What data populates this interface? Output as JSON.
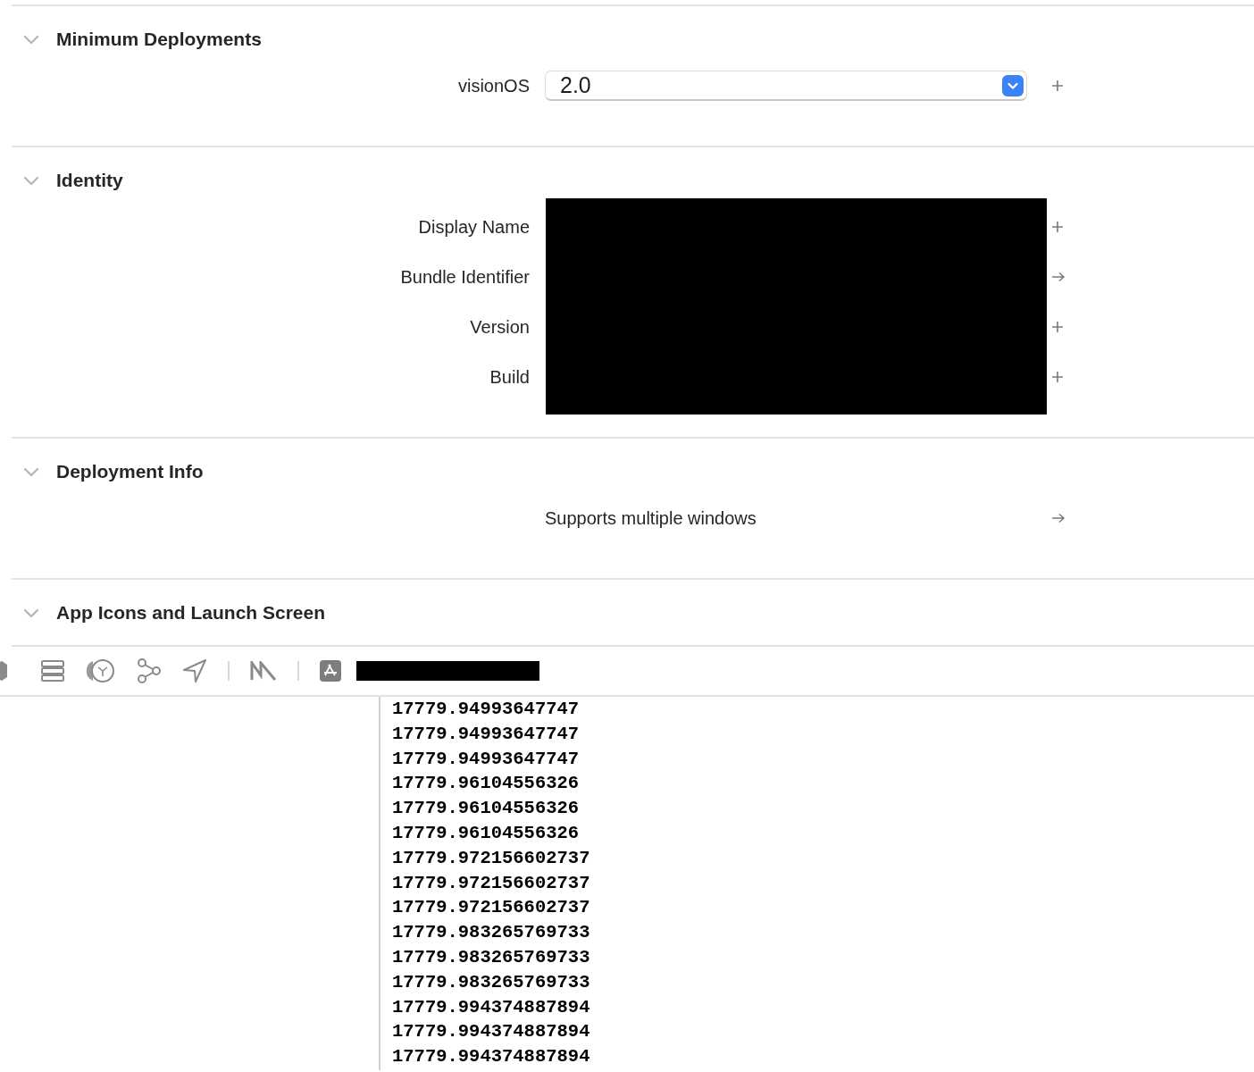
{
  "sections": [
    {
      "title": "Minimum Deployments",
      "expanded": true,
      "rows": [
        {
          "kind": "popup",
          "label": "visionOS",
          "value": "2.0",
          "action": {
            "kind": "plus"
          }
        }
      ]
    },
    {
      "title": "Identity",
      "expanded": true,
      "rows": [
        {
          "kind": "redacted",
          "label": "Display Name",
          "action": {
            "kind": "plus"
          }
        },
        {
          "kind": "redacted",
          "label": "Bundle Identifier",
          "action": {
            "kind": "arrow"
          }
        },
        {
          "kind": "redacted",
          "label": "Version",
          "action": {
            "kind": "plus"
          }
        },
        {
          "kind": "redacted",
          "label": "Build",
          "action": {
            "kind": "plus"
          }
        }
      ]
    },
    {
      "title": "Deployment Info",
      "expanded": true,
      "rows": [
        {
          "kind": "option",
          "text": "Supports multiple windows",
          "action": {
            "kind": "arrow"
          }
        }
      ]
    },
    {
      "title": "App Icons and Launch Screen",
      "expanded": true
    }
  ],
  "console_lines": [
    "17779.94993647747",
    "17779.94993647747",
    "17779.94993647747",
    "17779.96104556326",
    "17779.96104556326",
    "17779.96104556326",
    "17779.972156602737",
    "17779.972156602737",
    "17779.972156602737",
    "17779.983265769733",
    "17779.983265769733",
    "17779.983265769733",
    "17779.994374887894",
    "17779.994374887894",
    "17779.994374887894"
  ]
}
